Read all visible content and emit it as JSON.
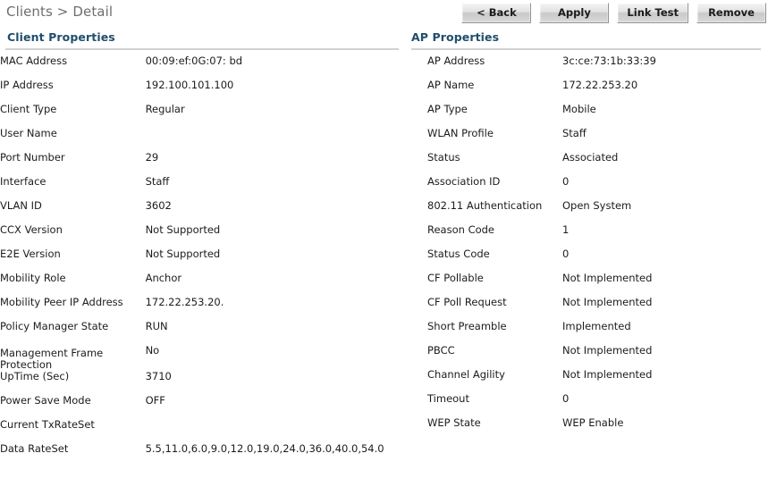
{
  "breadcrumb": "Clients > Detail",
  "toolbar": {
    "buttons": [
      {
        "label": "< Back",
        "name": "back-button"
      },
      {
        "label": "Apply",
        "name": "apply-button"
      },
      {
        "label": "Link Test",
        "name": "link-test-button"
      },
      {
        "label": "Remove",
        "name": "remove-button"
      }
    ]
  },
  "colors": {
    "section_header": "#1f4e6b",
    "breadcrumb": "#6e6e6e",
    "rule": "#d2d2d2",
    "button_face": "#d9d9d9"
  },
  "client_properties": {
    "title": "Client Properties",
    "rows": [
      {
        "label": "MAC Address",
        "value": "00:09:ef:0G:07: bd"
      },
      {
        "label": "IP Address",
        "value": "192.100.101.100"
      },
      {
        "label": "Client Type",
        "value": "Regular"
      },
      {
        "label": "User Name",
        "value": ""
      },
      {
        "label": "Port Number",
        "value": "29"
      },
      {
        "label": "Interface",
        "value": "Staff"
      },
      {
        "label": "VLAN ID",
        "value": "3602"
      },
      {
        "label": "CCX Version",
        "value": "Not Supported"
      },
      {
        "label": "E2E Version",
        "value": "Not Supported"
      },
      {
        "label": "Mobility Role",
        "value": "Anchor"
      },
      {
        "label": "Mobility Peer IP Address",
        "value": "172.22.253.20."
      },
      {
        "label": "Policy Manager State",
        "value": "RUN"
      },
      {
        "label": "Management Frame Protection",
        "value": "No",
        "two_line": true
      },
      {
        "label": "UpTime (Sec)",
        "value": "3710"
      },
      {
        "label": "Power Save Mode",
        "value": "OFF"
      },
      {
        "label": "Current TxRateSet",
        "value": ""
      },
      {
        "label": "Data RateSet",
        "value": "5.5,11.0,6.0,9.0,12.0,19.0,24.0,36.0,40.0,54.0"
      }
    ]
  },
  "ap_properties": {
    "title": "AP Properties",
    "rows": [
      {
        "label": "AP Address",
        "value": "3c:ce:73:1b:33:39"
      },
      {
        "label": "AP Name",
        "value": "172.22.253.20"
      },
      {
        "label": "AP Type",
        "value": "Mobile"
      },
      {
        "label": "WLAN Profile",
        "value": "Staff"
      },
      {
        "label": "Status",
        "value": "Associated"
      },
      {
        "label": "Association ID",
        "value": "0"
      },
      {
        "label": "802.11 Authentication",
        "value": "Open System"
      },
      {
        "label": "Reason Code",
        "value": "1"
      },
      {
        "label": "Status Code",
        "value": "0"
      },
      {
        "label": "CF Pollable",
        "value": "Not Implemented"
      },
      {
        "label": "CF Poll Request",
        "value": "Not Implemented"
      },
      {
        "label": "Short Preamble",
        "value": "Implemented"
      },
      {
        "label": "PBCC",
        "value": "Not Implemented"
      },
      {
        "label": "Channel Agility",
        "value": "Not Implemented"
      },
      {
        "label": "Timeout",
        "value": "0"
      },
      {
        "label": "WEP State",
        "value": "WEP Enable"
      }
    ]
  }
}
